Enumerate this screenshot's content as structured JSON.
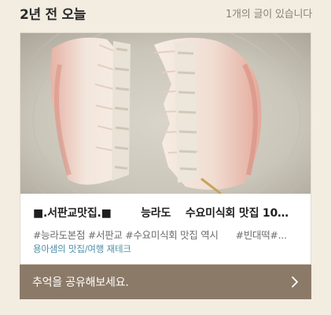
{
  "header": {
    "title": "2년 전 오늘",
    "count": "1개의 글이 있습니다"
  },
  "post": {
    "title": "■.서판교맛집.■        능라도    수요미식회 맛집 10월...",
    "tags": "#능라도본점 #서판교 #수요미식회 맛집 역시      #빈대떡#...",
    "source": "용아샘의 맛집/여행 재테크",
    "thumbnail_icon": "food-photo"
  },
  "share": {
    "label": "추억을 공유해보세요.",
    "icon": "chevron-right-icon"
  },
  "colors": {
    "background": "#f3ece1",
    "share_bar": "#8c7a68",
    "source_link": "#4f8fa8"
  }
}
